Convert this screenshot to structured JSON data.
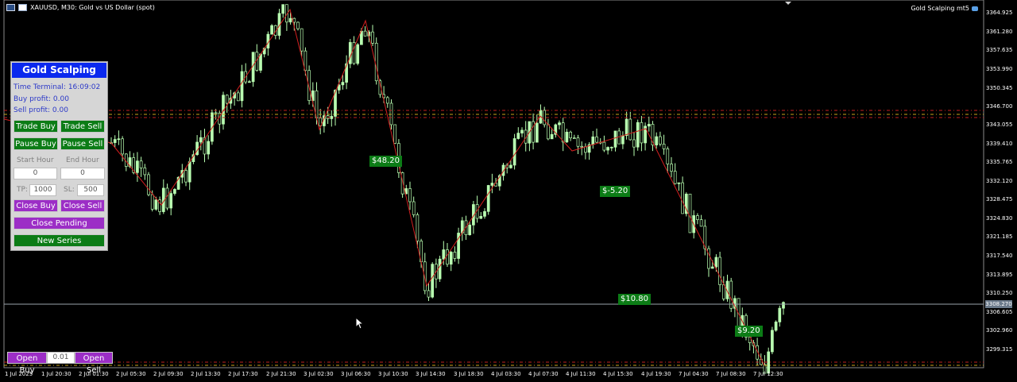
{
  "header": {
    "title": "XAUUSD, M30:  Gold vs US Dollar (spot)",
    "ea_name": "Gold Scalping mt5"
  },
  "panel": {
    "title": "Gold Scalping",
    "time_terminal": "Time Terminal: 16:09:02",
    "buy_profit": "Buy profit: 0.00",
    "sell_profit": "Sell profit: 0.00",
    "trade_buy": "Trade Buy",
    "trade_sell": "Trade Sell",
    "pause_buy": "Pause Buy",
    "pause_sell": "Pause Sell",
    "start_hour_label": "Start Hour",
    "end_hour_label": "End Hour",
    "start_hour": "0",
    "end_hour": "0",
    "tp_label": "TP:",
    "tp": "1000",
    "sl_label": "SL:",
    "sl": "500",
    "close_buy": "Close Buy",
    "close_sell": "Close Sell",
    "close_pending": "Close Pending",
    "new_series": "New Series"
  },
  "bottom": {
    "open_buy": "Open Buy",
    "lot": "0.01",
    "open_sell": "Open Sell"
  },
  "profit_tags": [
    "$48.20",
    "$-5.20",
    "$10.80",
    "$9.20"
  ],
  "price_axis": [
    "3364.925",
    "3361.280",
    "3357.635",
    "3353.990",
    "3350.345",
    "3346.700",
    "3343.055",
    "3339.410",
    "3335.765",
    "3332.120",
    "3328.475",
    "3324.830",
    "3321.185",
    "3317.540",
    "3313.895",
    "3310.250",
    "3306.605",
    "3302.960",
    "3299.315"
  ],
  "current_price": "3308.270",
  "time_axis": [
    "1 Jul 2025",
    "1 Jul 20:30",
    "2 Jul 01:30",
    "2 Jul 05:30",
    "2 Jul 09:30",
    "2 Jul 13:30",
    "2 Jul 17:30",
    "2 Jul 21:30",
    "3 Jul 02:30",
    "3 Jul 06:30",
    "3 Jul 10:30",
    "3 Jul 14:30",
    "3 Jul 18:30",
    "4 Jul 03:30",
    "4 Jul 07:30",
    "4 Jul 11:30",
    "4 Jul 15:30",
    "4 Jul 19:30",
    "7 Jul 04:30",
    "7 Jul 08:30",
    "7 Jul 12:30"
  ],
  "colors": {
    "candle": "#b9ffb1",
    "zigzag": "#d21f1f",
    "panel_title": "#0b29ee",
    "green_button": "#0c7c16",
    "purple_button": "#9c2ec6",
    "info_text": "#2b38c8"
  }
}
